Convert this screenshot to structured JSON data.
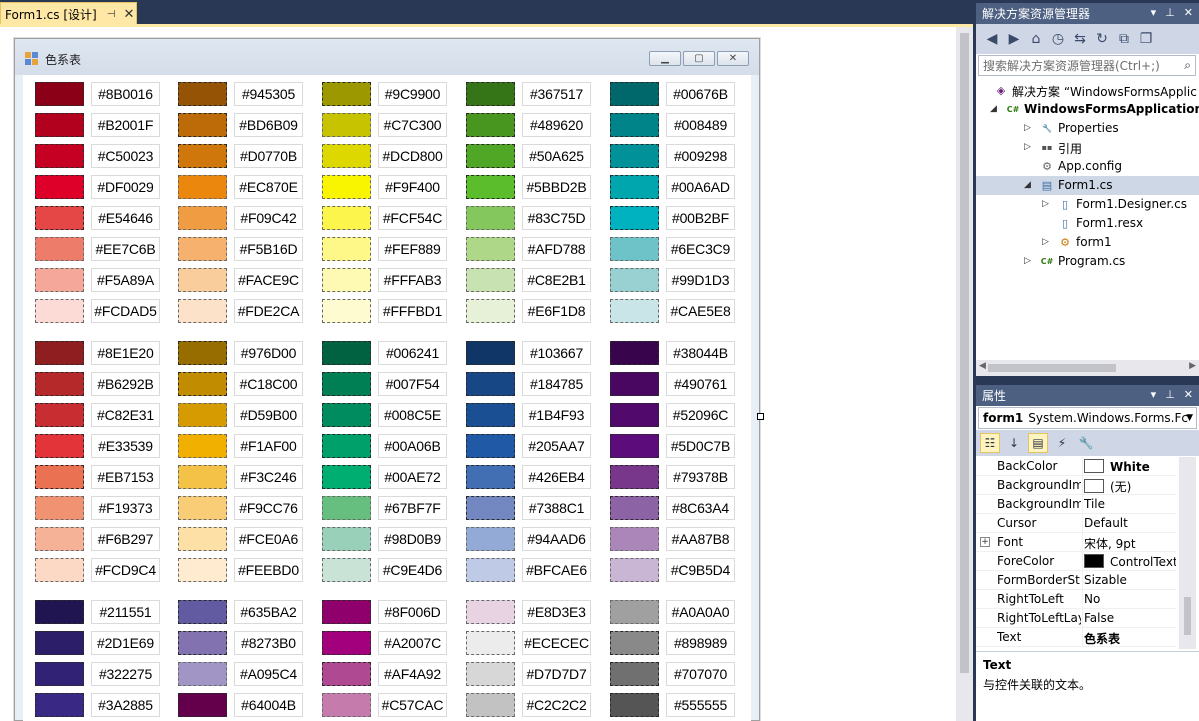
{
  "document_tab": {
    "label": "Form1.cs [设计]",
    "pin_icon": "pin-icon",
    "close_icon": "close-icon"
  },
  "form": {
    "title": "色系表",
    "buttons": {
      "minimize": "minimize-button",
      "maximize": "maximize-button",
      "close": "close-button"
    },
    "color_groups": [
      {
        "columns": [
          [
            "#8B0016",
            "#B2001F",
            "#C50023",
            "#DF0029",
            "#E54646",
            "#EE7C6B",
            "#F5A89A",
            "#FCDAD5"
          ],
          [
            "#945305",
            "#BD6B09",
            "#D0770B",
            "#EC870E",
            "#F09C42",
            "#F5B16D",
            "#FACE9C",
            "#FDE2CA"
          ],
          [
            "#9C9900",
            "#C7C300",
            "#DCD800",
            "#F9F400",
            "#FCF54C",
            "#FEF889",
            "#FFFAB3",
            "#FFFBD1"
          ],
          [
            "#367517",
            "#489620",
            "#50A625",
            "#5BBD2B",
            "#83C75D",
            "#AFD788",
            "#C8E2B1",
            "#E6F1D8"
          ],
          [
            "#00676B",
            "#008489",
            "#009298",
            "#00A6AD",
            "#00B2BF",
            "#6EC3C9",
            "#99D1D3",
            "#CAE5E8"
          ]
        ]
      },
      {
        "columns": [
          [
            "#8E1E20",
            "#B6292B",
            "#C82E31",
            "#E33539",
            "#EB7153",
            "#F19373",
            "#F6B297",
            "#FCD9C4"
          ],
          [
            "#976D00",
            "#C18C00",
            "#D59B00",
            "#F1AF00",
            "#F3C246",
            "#F9CC76",
            "#FCE0A6",
            "#FEEBD0"
          ],
          [
            "#006241",
            "#007F54",
            "#008C5E",
            "#00A06B",
            "#00AE72",
            "#67BF7F",
            "#98D0B9",
            "#C9E4D6"
          ],
          [
            "#103667",
            "#184785",
            "#1B4F93",
            "#205AA7",
            "#426EB4",
            "#7388C1",
            "#94AAD6",
            "#BFCAE6"
          ],
          [
            "#38044B",
            "#490761",
            "#52096C",
            "#5D0C7B",
            "#79378B",
            "#8C63A4",
            "#AA87B8",
            "#C9B5D4"
          ]
        ]
      },
      {
        "columns": [
          [
            "#211551",
            "#2D1E69",
            "#322275",
            "#3A2885"
          ],
          [
            "#635BA2",
            "#8273B0",
            "#A095C4",
            "#64004B"
          ],
          [
            "#8F006D",
            "#A2007C",
            "#AF4A92",
            "#C57CAC"
          ],
          [
            "#E8D3E3",
            "#ECECEC",
            "#D7D7D7",
            "#C2C2C2"
          ],
          [
            "#A0A0A0",
            "#898989",
            "#707070",
            "#555555"
          ]
        ]
      }
    ]
  },
  "solution_explorer": {
    "title": "解决方案资源管理器",
    "search_placeholder": "搜索解决方案资源管理器(Ctrl+;)",
    "tree": [
      {
        "label": "解决方案 “WindowsFormsApplic",
        "icon": "solution-icon",
        "level": 0,
        "arrow": ""
      },
      {
        "label": "WindowsFormsApplication",
        "icon": "csharp-project-icon",
        "level": 0,
        "arrow": "expanded",
        "bold": true
      },
      {
        "label": "Properties",
        "icon": "wrench-icon",
        "level": 1,
        "arrow": "collapsed"
      },
      {
        "label": "引用",
        "icon": "references-icon",
        "level": 1,
        "arrow": "collapsed"
      },
      {
        "label": "App.config",
        "icon": "config-file-icon",
        "level": 1,
        "arrow": ""
      },
      {
        "label": "Form1.cs",
        "icon": "form-file-icon",
        "level": 1,
        "arrow": "expanded",
        "selected": true
      },
      {
        "label": "Form1.Designer.cs",
        "icon": "cs-file-icon",
        "level": 2,
        "arrow": "collapsed"
      },
      {
        "label": "Form1.resx",
        "icon": "resx-file-icon",
        "level": 2,
        "arrow": ""
      },
      {
        "label": "form1",
        "icon": "class-icon",
        "level": 2,
        "arrow": "collapsed"
      },
      {
        "label": "Program.cs",
        "icon": "csharp-file-icon",
        "level": 1,
        "arrow": "collapsed"
      }
    ]
  },
  "properties": {
    "title": "属性",
    "object_name": "form1",
    "object_type": "System.Windows.Forms.Fc",
    "rows": [
      {
        "name": "BackColor",
        "value": "White",
        "chip": "#FFFFFF",
        "bold": true
      },
      {
        "name": "BackgroundIm",
        "value": "(无)",
        "chip": "#FFFFFF"
      },
      {
        "name": "BackgroundIm",
        "value": "Tile"
      },
      {
        "name": "Cursor",
        "value": "Default"
      },
      {
        "name": "Font",
        "value": "宋体, 9pt",
        "expandable": true
      },
      {
        "name": "ForeColor",
        "value": "ControlText",
        "chip": "#000000"
      },
      {
        "name": "FormBorderSt",
        "value": "Sizable"
      },
      {
        "name": "RightToLeft",
        "value": "No"
      },
      {
        "name": "RightToLeftLay",
        "value": "False"
      },
      {
        "name": "Text",
        "value": "色系表",
        "bold": true
      }
    ],
    "description_title": "Text",
    "description_text": "与控件关联的文本。"
  }
}
